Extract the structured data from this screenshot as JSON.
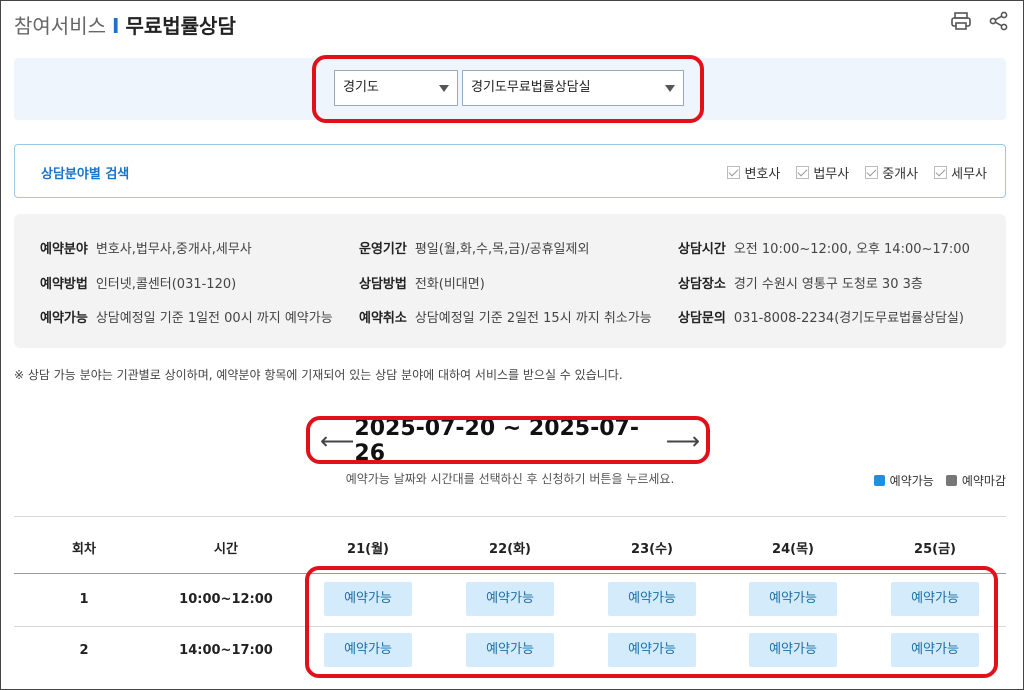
{
  "header": {
    "breadcrumb": "참여서비스",
    "separator": "I",
    "page_title": "무료법률상담",
    "icons": [
      "print-icon",
      "share-icon"
    ]
  },
  "region": {
    "province": "경기도",
    "office": "경기도무료법률상담실"
  },
  "field_search": {
    "title": "상담분야별 검색",
    "options": [
      {
        "label": "변호사",
        "checked": true
      },
      {
        "label": "법무사",
        "checked": true
      },
      {
        "label": "중개사",
        "checked": true
      },
      {
        "label": "세무사",
        "checked": true
      }
    ]
  },
  "info": {
    "field_k": "예약분야",
    "field_v": "변호사,법무사,중개사,세무사",
    "period_k": "운영기간",
    "period_v": "평일(월,화,수,목,금)/공휴일제외",
    "time_k": "상담시간",
    "time_v": "오전 10:00~12:00, 오후 14:00~17:00",
    "method_k": "예약방법",
    "method_v": "인터넷,콜센터(031-120)",
    "consult_k": "상담방법",
    "consult_v": "전화(비대면)",
    "place_k": "상담장소",
    "place_v": "경기 수원시 영통구 도청로 30  3층",
    "avail_k": "예약가능",
    "avail_v": "상담예정일 기준 1일전 00시 까지 예약가능",
    "cancel_k": "예약취소",
    "cancel_v": "상담예정일 기준 2일전 15시 까지 취소가능",
    "contact_k": "상담문의",
    "contact_v": "031-8008-2234(경기도무료법률상담실)"
  },
  "notice": "※ 상담 가능 분야는 기관별로 상이하며, 예약분야 항목에 기재되어 있는 상담 분야에 대하여 서비스를 받으실 수 있습니다.",
  "date_nav": {
    "prev": "⟵",
    "range": "2025-07-20 ~ 2025-07-26",
    "next": "⟶"
  },
  "guide": "예약가능 날짜와 시간대를 선택하신 후 신청하기 버튼을 누르세요.",
  "legend": {
    "available": "예약가능",
    "available_color": "#1e90e0",
    "closed": "예약마감",
    "closed_color": "#777777"
  },
  "table": {
    "headers": [
      "회차",
      "시간",
      "21(월)",
      "22(화)",
      "23(수)",
      "24(목)",
      "25(금)"
    ],
    "rows": [
      {
        "round": "1",
        "time": "10:00~12:00",
        "slots": [
          "예약가능",
          "예약가능",
          "예약가능",
          "예약가능",
          "예약가능"
        ]
      },
      {
        "round": "2",
        "time": "14:00~17:00",
        "slots": [
          "예약가능",
          "예약가능",
          "예약가능",
          "예약가능",
          "예약가능"
        ]
      }
    ]
  },
  "highlight_color": "#e3101a"
}
